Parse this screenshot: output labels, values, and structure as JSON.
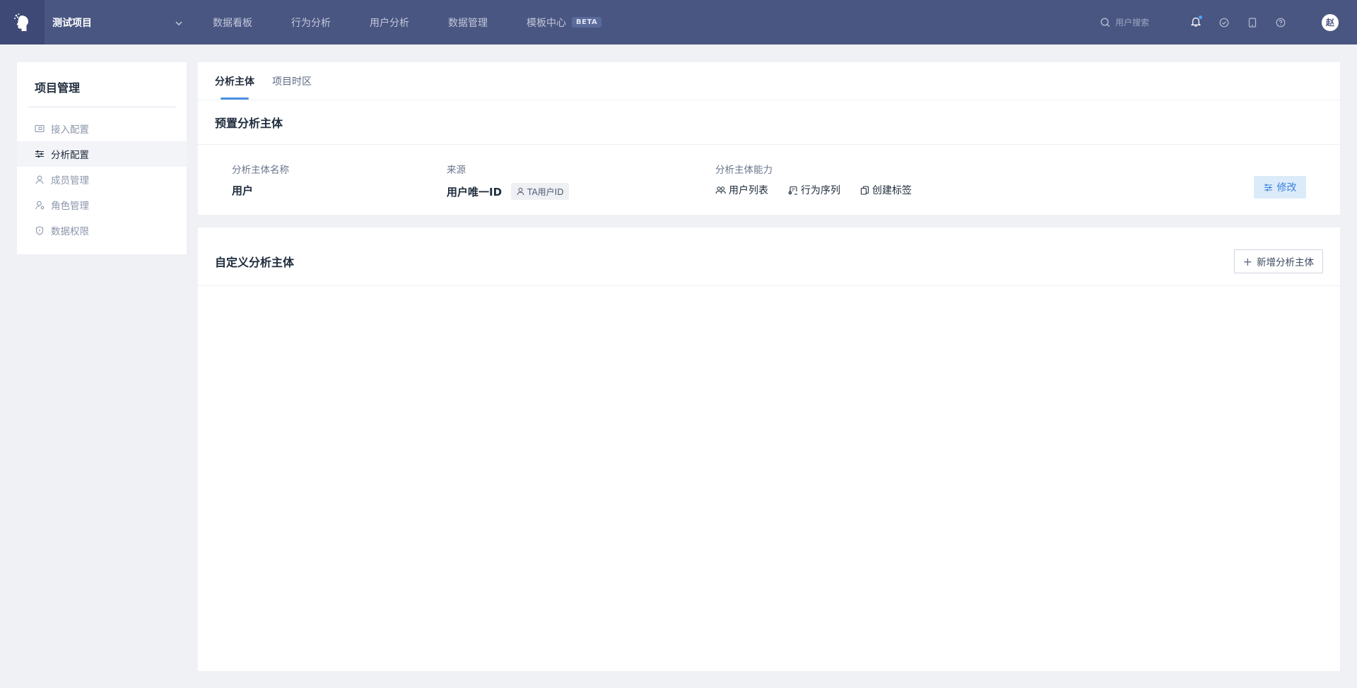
{
  "header": {
    "project_name": "测试项目",
    "menu": [
      {
        "label": "数据看板"
      },
      {
        "label": "行为分析"
      },
      {
        "label": "用户分析"
      },
      {
        "label": "数据管理"
      },
      {
        "label": "模板中心",
        "badge": "BETA"
      }
    ],
    "search_placeholder": "用户搜索",
    "avatar_text": "赵",
    "icons": [
      "bell-icon",
      "check-circle-icon",
      "tablet-icon",
      "help-icon"
    ]
  },
  "sidebar": {
    "title": "项目管理",
    "items": [
      {
        "label": "接入配置",
        "icon": "connect-icon",
        "active": false
      },
      {
        "label": "分析配置",
        "icon": "sliders-icon",
        "active": true
      },
      {
        "label": "成员管理",
        "icon": "user-icon",
        "active": false
      },
      {
        "label": "角色管理",
        "icon": "role-icon",
        "active": false
      },
      {
        "label": "数据权限",
        "icon": "shield-icon",
        "active": false
      }
    ]
  },
  "main": {
    "tabs": [
      {
        "label": "分析主体",
        "active": true
      },
      {
        "label": "项目时区",
        "active": false
      }
    ],
    "preset": {
      "title": "预置分析主体",
      "name_label": "分析主体名称",
      "name_value": "用户",
      "source_label": "来源",
      "source_value": "用户唯一ID",
      "source_tag": "TA用户ID",
      "caps_label": "分析主体能力",
      "caps": [
        {
          "label": "用户列表",
          "icon": "users-icon"
        },
        {
          "label": "行为序列",
          "icon": "sequence-icon"
        },
        {
          "label": "创建标签",
          "icon": "tag-icon"
        }
      ],
      "edit_label": "修改"
    },
    "custom": {
      "title": "自定义分析主体",
      "add_label": "新增分析主体"
    }
  },
  "colors": {
    "nav_bg": "#4a5682",
    "accent": "#4a90e2",
    "page_bg": "#f0f1f5"
  }
}
